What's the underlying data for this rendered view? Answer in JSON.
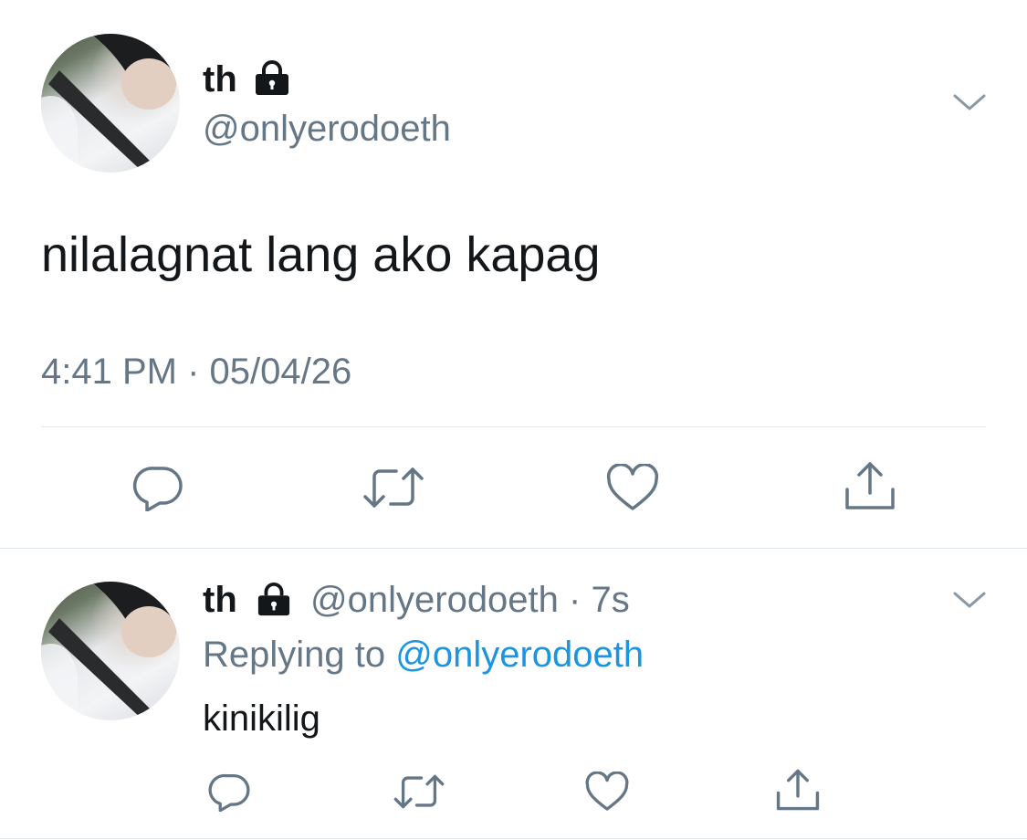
{
  "main_tweet": {
    "display_name": "th",
    "handle": "@onlyerodoeth",
    "text": "nilalagnat lang ako kapag",
    "timestamp": "4:41 PM · 05/04/26",
    "icons": [
      "lock-icon",
      "chevron-down-icon",
      "reply-icon",
      "retweet-icon",
      "like-icon",
      "share-icon"
    ]
  },
  "reply_tweet": {
    "display_name": "th",
    "handle": "@onlyerodoeth",
    "age": "· 7s",
    "replying_prefix": "Replying to",
    "replying_handle": "@onlyerodoeth",
    "text": "kinikilig",
    "icons": [
      "lock-icon",
      "chevron-down-icon",
      "reply-icon",
      "retweet-icon",
      "like-icon",
      "share-icon"
    ]
  },
  "colors": {
    "text": "#14171a",
    "secondary": "#657786",
    "link": "#1b95e0",
    "divider": "#e1e8ed"
  }
}
